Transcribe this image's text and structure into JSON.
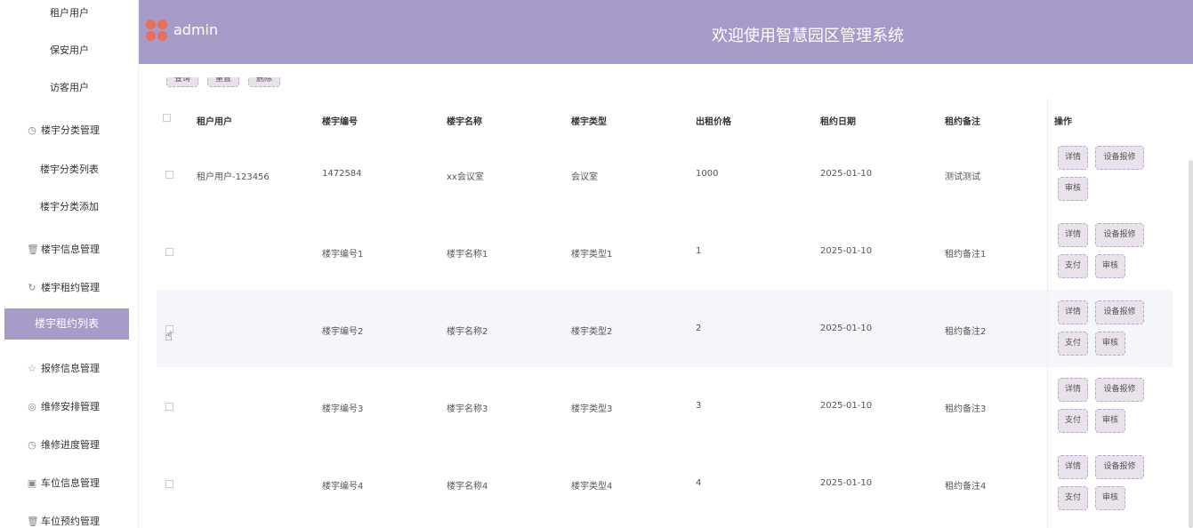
{
  "sidebar": {
    "items": [
      {
        "label": "租户用户",
        "icon": ""
      },
      {
        "label": "保安用户",
        "icon": ""
      },
      {
        "label": "访客用户",
        "icon": ""
      },
      {
        "label": "楼宇分类管理",
        "icon": "clock-icon"
      },
      {
        "label": "楼宇分类列表",
        "icon": ""
      },
      {
        "label": "楼宇分类添加",
        "icon": ""
      },
      {
        "label": "楼宇信息管理",
        "icon": "trash-icon"
      },
      {
        "label": "楼宇租约管理",
        "icon": "refresh-icon"
      },
      {
        "label": "楼宇租约列表",
        "icon": ""
      },
      {
        "label": "报修信息管理",
        "icon": "star-icon"
      },
      {
        "label": "维修安排管理",
        "icon": "compass-icon"
      },
      {
        "label": "维修进度管理",
        "icon": "clock-icon"
      },
      {
        "label": "车位信息管理",
        "icon": "calendar-icon"
      },
      {
        "label": "车位预约管理",
        "icon": "trash-icon"
      }
    ],
    "active_index": 8
  },
  "header": {
    "user": "admin",
    "welcome": "欢迎使用智慧园区管理系统"
  },
  "toolbar": {
    "query": "查询",
    "add": "重置",
    "delete": "删除"
  },
  "table": {
    "headers": [
      "租户用户",
      "楼宇编号",
      "楼宇名称",
      "楼宇类型",
      "出租价格",
      "租约日期",
      "租约备注",
      "操作"
    ],
    "rows": [
      {
        "tenant": "租户用户-123456",
        "code": "1472584",
        "name": "xx会议室",
        "type": "会议室",
        "price": "1000",
        "date": "2025-01-10",
        "note": "测试测试",
        "actions": [
          "详情",
          "设备报修",
          "审核"
        ]
      },
      {
        "tenant": "",
        "code": "楼宇编号1",
        "name": "楼宇名称1",
        "type": "楼宇类型1",
        "price": "1",
        "date": "2025-01-10",
        "note": "租约备注1",
        "actions": [
          "详情",
          "设备报修",
          "支付",
          "审核"
        ]
      },
      {
        "tenant": "",
        "code": "楼宇编号2",
        "name": "楼宇名称2",
        "type": "楼宇类型2",
        "price": "2",
        "date": "2025-01-10",
        "note": "租约备注2",
        "actions": [
          "详情",
          "设备报修",
          "支付",
          "审核"
        ]
      },
      {
        "tenant": "",
        "code": "楼宇编号3",
        "name": "楼宇名称3",
        "type": "楼宇类型3",
        "price": "3",
        "date": "2025-01-10",
        "note": "租约备注3",
        "actions": [
          "详情",
          "设备报修",
          "支付",
          "审核"
        ]
      },
      {
        "tenant": "",
        "code": "楼宇编号4",
        "name": "楼宇名称4",
        "type": "楼宇类型4",
        "price": "4",
        "date": "2025-01-10",
        "note": "租约备注4",
        "actions": [
          "详情",
          "设备报修",
          "支付",
          "审核"
        ]
      }
    ]
  },
  "colors": {
    "accent": "#a79bc9",
    "button_bg": "#e9e2ea",
    "logo": "#e8705a"
  }
}
